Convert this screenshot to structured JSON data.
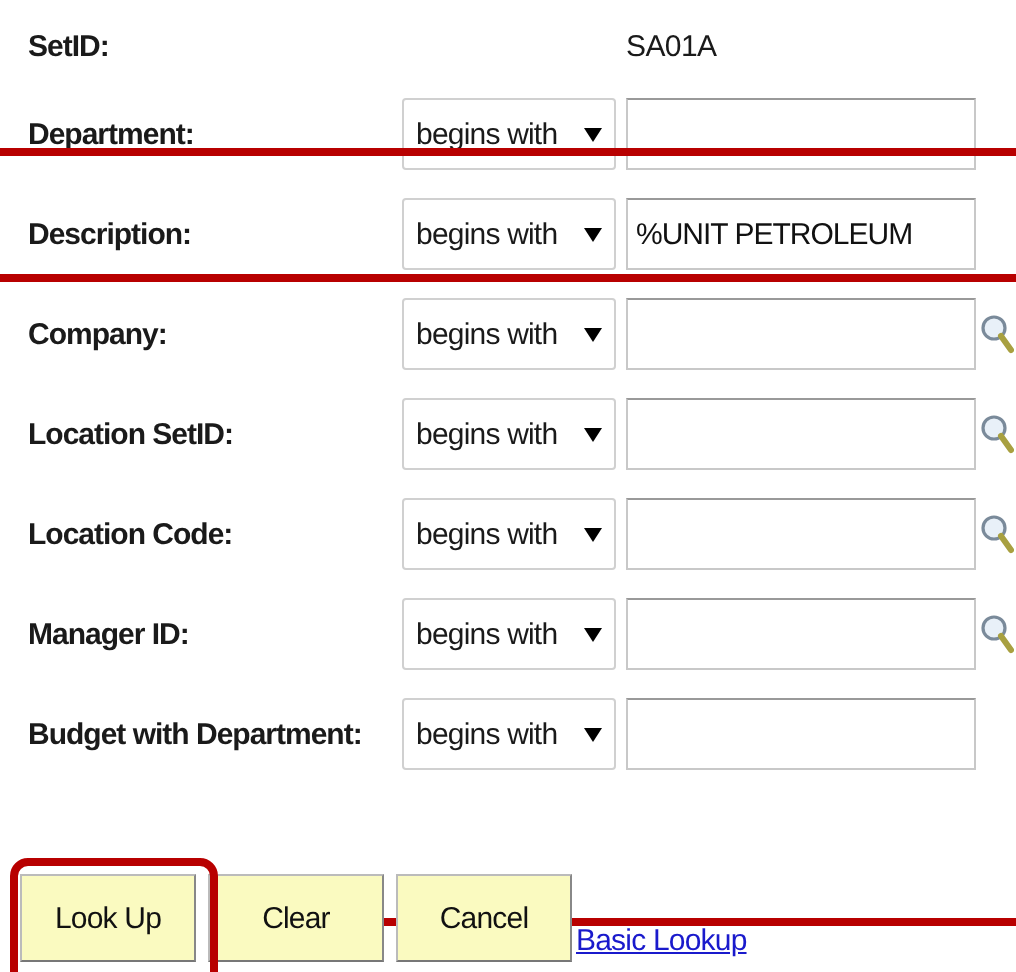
{
  "setid": {
    "label": "SetID:",
    "value": "SA01A"
  },
  "fields": [
    {
      "label": "Department:",
      "operator": "begins with",
      "lookup": false
    },
    {
      "label": "Description:",
      "operator": "begins with",
      "value": "%UNIT PETROLEUM",
      "lookup": false
    },
    {
      "label": "Company:",
      "operator": "begins with",
      "lookup": true
    },
    {
      "label": "Location SetID:",
      "operator": "begins with",
      "lookup": true
    },
    {
      "label": "Location Code:",
      "operator": "begins with",
      "lookup": true
    },
    {
      "label": "Manager ID:",
      "operator": "begins with",
      "lookup": true
    },
    {
      "label": "Budget with Department:",
      "operator": "begins with",
      "lookup": false
    }
  ],
  "buttons": [
    "Look Up",
    "Clear",
    "Cancel"
  ],
  "link": "Basic Lookup"
}
